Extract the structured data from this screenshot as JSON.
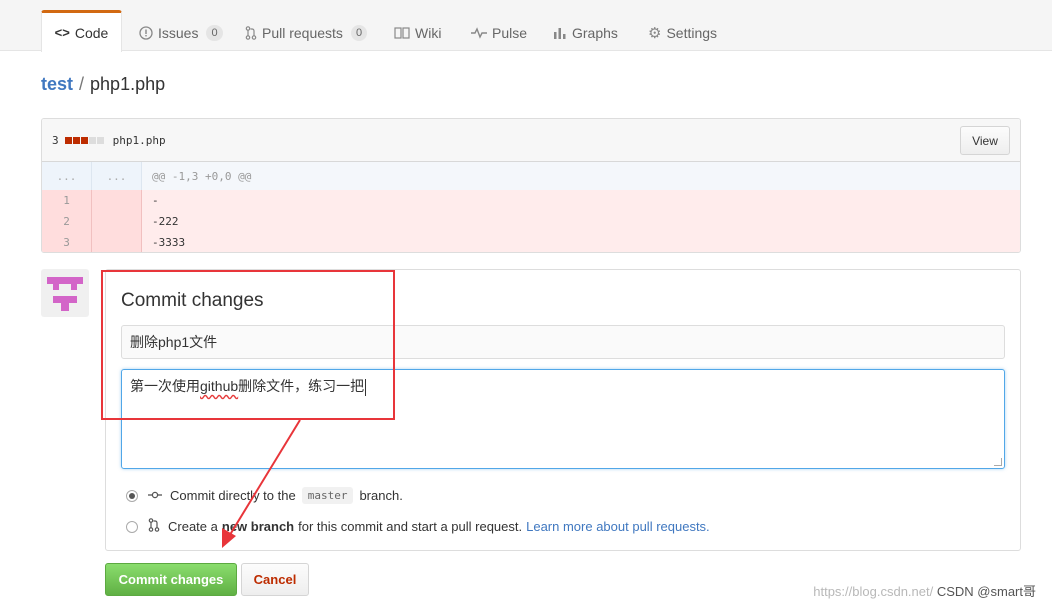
{
  "tabs": [
    {
      "label": "Code",
      "icon": "code-icon",
      "selected": true
    },
    {
      "label": "Issues",
      "icon": "issue-icon",
      "count": "0"
    },
    {
      "label": "Pull requests",
      "icon": "pull-request-icon",
      "count": "0"
    },
    {
      "label": "Wiki",
      "icon": "book-icon"
    },
    {
      "label": "Pulse",
      "icon": "pulse-icon"
    },
    {
      "label": "Graphs",
      "icon": "graph-icon"
    },
    {
      "label": "Settings",
      "icon": "gear-icon"
    }
  ],
  "breadcrumb": {
    "repo": "test",
    "separator": "/",
    "file": "php1.php"
  },
  "diff": {
    "stat_count": "3",
    "file_name": "php1.php",
    "view_label": "View",
    "hunk_dots_left": "...",
    "hunk_dots_right": "...",
    "hunk_header": "@@ -1,3 +0,0 @@",
    "lines": [
      {
        "num": "1",
        "text": "-"
      },
      {
        "num": "2",
        "text": "-222"
      },
      {
        "num": "3",
        "text": "-3333"
      }
    ]
  },
  "commit": {
    "title": "Commit changes",
    "summary_value": "删除php1文件",
    "description_before": "第一次使用",
    "description_spell": "github",
    "description_after": "删除文件，练习一把",
    "option1": {
      "text_before": "Commit directly to the",
      "branch": "master",
      "text_after": "branch."
    },
    "option2": {
      "text_before": "Create a",
      "bold": "new branch",
      "text_after": "for this commit and start a pull request.",
      "link": "Learn more about pull requests."
    },
    "submit_label": "Commit changes",
    "cancel_label": "Cancel"
  },
  "watermark": {
    "faint": "https://blog.csdn.net/",
    "text": "CSDN @smart哥"
  },
  "colors": {
    "accent": "#d26911",
    "link": "#4078c0",
    "green": "#60b044",
    "annotation": "#e8353a"
  }
}
